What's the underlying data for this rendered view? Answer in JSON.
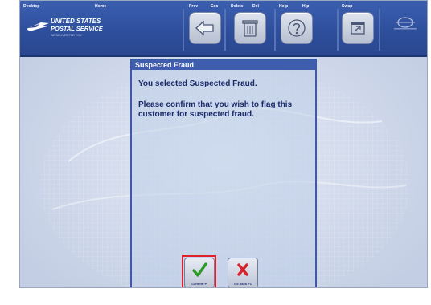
{
  "toolbar": {
    "desktop_label": "Desktop",
    "home_label": "Home",
    "prev_label": "Prev",
    "esc_label": "Esc",
    "delete_label": "Delete",
    "del_label": "Del",
    "help_label": "Help",
    "hlp_label": "Hlp",
    "swap_label": "Swap",
    "buttons": {
      "prev_icon": "left-arrow-icon",
      "delete_icon": "trash-icon",
      "help_icon": "question-icon",
      "swap_icon": "swap-window-icon"
    }
  },
  "logo": {
    "line1": "UNITED STATES",
    "line2": "POSTAL SERVICE",
    "tagline": "WE DELIVER FOR YOU"
  },
  "dialog": {
    "title": "Suspected Fraud",
    "message1": "You selected Suspected Fraud.",
    "message2": "Please confirm that you wish to flag this customer for suspected fraud."
  },
  "actions": {
    "confirm_label": "Confirm ↵",
    "goback_label": "Go Back F1",
    "confirm_icon": "checkmark-icon",
    "goback_icon": "x-icon",
    "confirm_color": "#2e9a2a",
    "goback_color": "#d7222a",
    "highlight_color": "#e0202a"
  }
}
